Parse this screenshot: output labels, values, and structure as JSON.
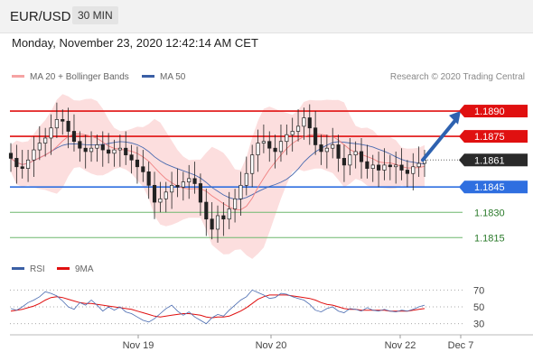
{
  "header": {
    "symbol": "EUR/USD",
    "timeframe": "30 MIN"
  },
  "datetime": "Monday, November 23, 2020 12:42:14 AM CET",
  "legend": {
    "ma20_label": "MA 20 + Bollinger Bands",
    "ma50_label": "MA 50",
    "rsi_label": "RSI",
    "rsi_ma_label": "9MA"
  },
  "credit": "Research © 2020 Trading Central",
  "colors": {
    "resistance": "#e01010",
    "support": "#2f6fe0",
    "target": "#6fb86f",
    "bollinger": "#fbd3d3",
    "ma20": "#f08080",
    "ma50": "#4a6bb0",
    "candle": "#222222",
    "arrow": "#2e62b0",
    "rsi": "#4a6bb0",
    "rsi_ma": "#e01010",
    "current_price_bg": "#2a2a2a"
  },
  "chart_data": {
    "type": "candlestick",
    "price_ylim": [
      1.1805,
      1.1905
    ],
    "levels": [
      {
        "label": "1.1890",
        "value": 1.189,
        "kind": "resistance"
      },
      {
        "label": "1.1875",
        "value": 1.1875,
        "kind": "resistance"
      },
      {
        "label": "1.1861",
        "value": 1.1861,
        "kind": "current"
      },
      {
        "label": "1.1845",
        "value": 1.1845,
        "kind": "support"
      },
      {
        "label": "1.1830",
        "value": 1.183,
        "kind": "target"
      },
      {
        "label": "1.1815",
        "value": 1.1815,
        "kind": "target"
      }
    ],
    "forecast_arrow": {
      "from": 1.1861,
      "to": 1.1889
    },
    "x_ticks": [
      "Nov 19",
      "Nov 20",
      "Nov 22",
      "Dec 7"
    ],
    "rsi_ticks": [
      "70",
      "50",
      "30"
    ],
    "rsi_ylim": [
      20,
      80
    ],
    "price_series": [
      1.1862,
      1.1857,
      1.1856,
      1.1861,
      1.1867,
      1.1871,
      1.1874,
      1.188,
      1.1885,
      1.1884,
      1.1878,
      1.1872,
      1.1868,
      1.1866,
      1.1868,
      1.187,
      1.1867,
      1.1865,
      1.1867,
      1.1868,
      1.1864,
      1.1861,
      1.1857,
      1.1854,
      1.1846,
      1.1836,
      1.1838,
      1.1842,
      1.1846,
      1.1845,
      1.1848,
      1.185,
      1.1847,
      1.1836,
      1.1826,
      1.182,
      1.1828,
      1.1826,
      1.1832,
      1.1838,
      1.1846,
      1.1853,
      1.1864,
      1.1871,
      1.1872,
      1.1868,
      1.1866,
      1.1872,
      1.1876,
      1.1878,
      1.1881,
      1.1886,
      1.188,
      1.187,
      1.1866,
      1.1868,
      1.187,
      1.1862,
      1.1858,
      1.1864,
      1.1866,
      1.186,
      1.1856,
      1.1858,
      1.1855,
      1.1858,
      1.1857,
      1.1858,
      1.1855,
      1.1853,
      1.1857,
      1.1859,
      1.1861
    ],
    "rsi": [
      48,
      46,
      50,
      55,
      58,
      62,
      68,
      66,
      63,
      57,
      50,
      47,
      55,
      52,
      58,
      52,
      45,
      50,
      46,
      50,
      44,
      42,
      38,
      34,
      32,
      36,
      42,
      48,
      52,
      45,
      40,
      44,
      38,
      34,
      30,
      37,
      41,
      39,
      46,
      52,
      58,
      62,
      70,
      67,
      64,
      60,
      61,
      66,
      65,
      62,
      60,
      58,
      53,
      46,
      44,
      48,
      50,
      45,
      43,
      48,
      47,
      45,
      49,
      46,
      45,
      47,
      45,
      44,
      46,
      45,
      47,
      50,
      52
    ],
    "rsi_ma": [
      45,
      46,
      47,
      49,
      51,
      54,
      58,
      61,
      62,
      61,
      59,
      57,
      55,
      54,
      54,
      53,
      52,
      51,
      50,
      49,
      48,
      47,
      45,
      43,
      41,
      39,
      38,
      39,
      40,
      41,
      42,
      42,
      41,
      40,
      38,
      37,
      38,
      38,
      39,
      42,
      45,
      49,
      54,
      59,
      62,
      64,
      64,
      64,
      64,
      63,
      62,
      61,
      60,
      58,
      55,
      53,
      52,
      50,
      48,
      47,
      47,
      46,
      46,
      46,
      46,
      46,
      45,
      45,
      45,
      45,
      46,
      47,
      48
    ]
  }
}
